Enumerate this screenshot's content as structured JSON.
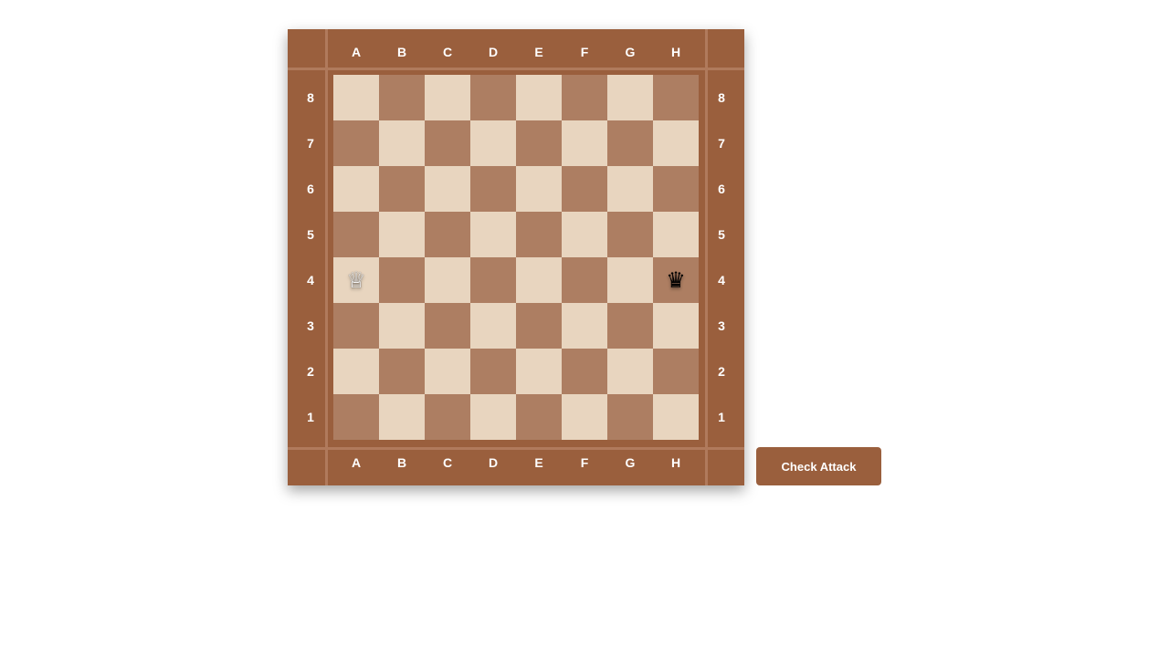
{
  "board": {
    "files": [
      "A",
      "B",
      "C",
      "D",
      "E",
      "F",
      "G",
      "H"
    ],
    "ranks": [
      "8",
      "7",
      "6",
      "5",
      "4",
      "3",
      "2",
      "1"
    ],
    "light_color": "#e8d5bf",
    "dark_color": "#ad7e62",
    "frame_color": "#9a5f3d",
    "pieces": [
      {
        "square": "A4",
        "type": "queen",
        "color": "white",
        "glyph": "♕"
      },
      {
        "square": "H4",
        "type": "queen",
        "color": "black",
        "glyph": "♛"
      }
    ]
  },
  "actions": {
    "check_attack_label": "Check Attack"
  }
}
